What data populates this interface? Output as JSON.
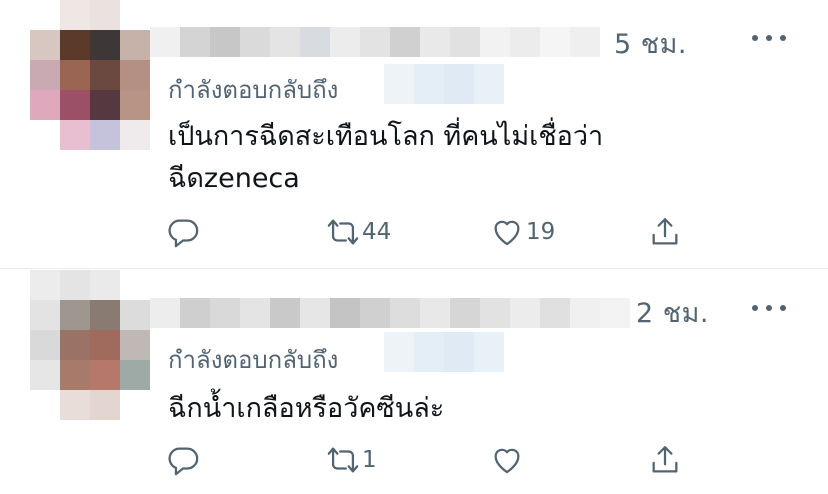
{
  "tweets": [
    {
      "time": "5 ชม.",
      "reply_label": "กำลังตอบกลับถึง",
      "text_lines": [
        "เป็นการฉีดสะเทือนโลก ที่คนไม่เชื่อว่า",
        "ฉีดzeneca"
      ],
      "actions": {
        "retweets": "44",
        "likes": "19"
      }
    },
    {
      "time": "2 ชม.",
      "reply_label": "กำลังตอบกลับถึง",
      "text_lines": [
        "ฉีกน้ำเกลือหรือวัคซีนล่ะ"
      ],
      "actions": {
        "retweets": "1",
        "likes": ""
      }
    }
  ],
  "icons": {
    "reply": "reply-icon",
    "retweet": "retweet-icon",
    "like": "heart-icon",
    "share": "share-icon",
    "more": "more-icon"
  },
  "colors": {
    "secondary_text": "#536471",
    "primary_text": "#0f1419",
    "divider": "#e6ecf0"
  }
}
